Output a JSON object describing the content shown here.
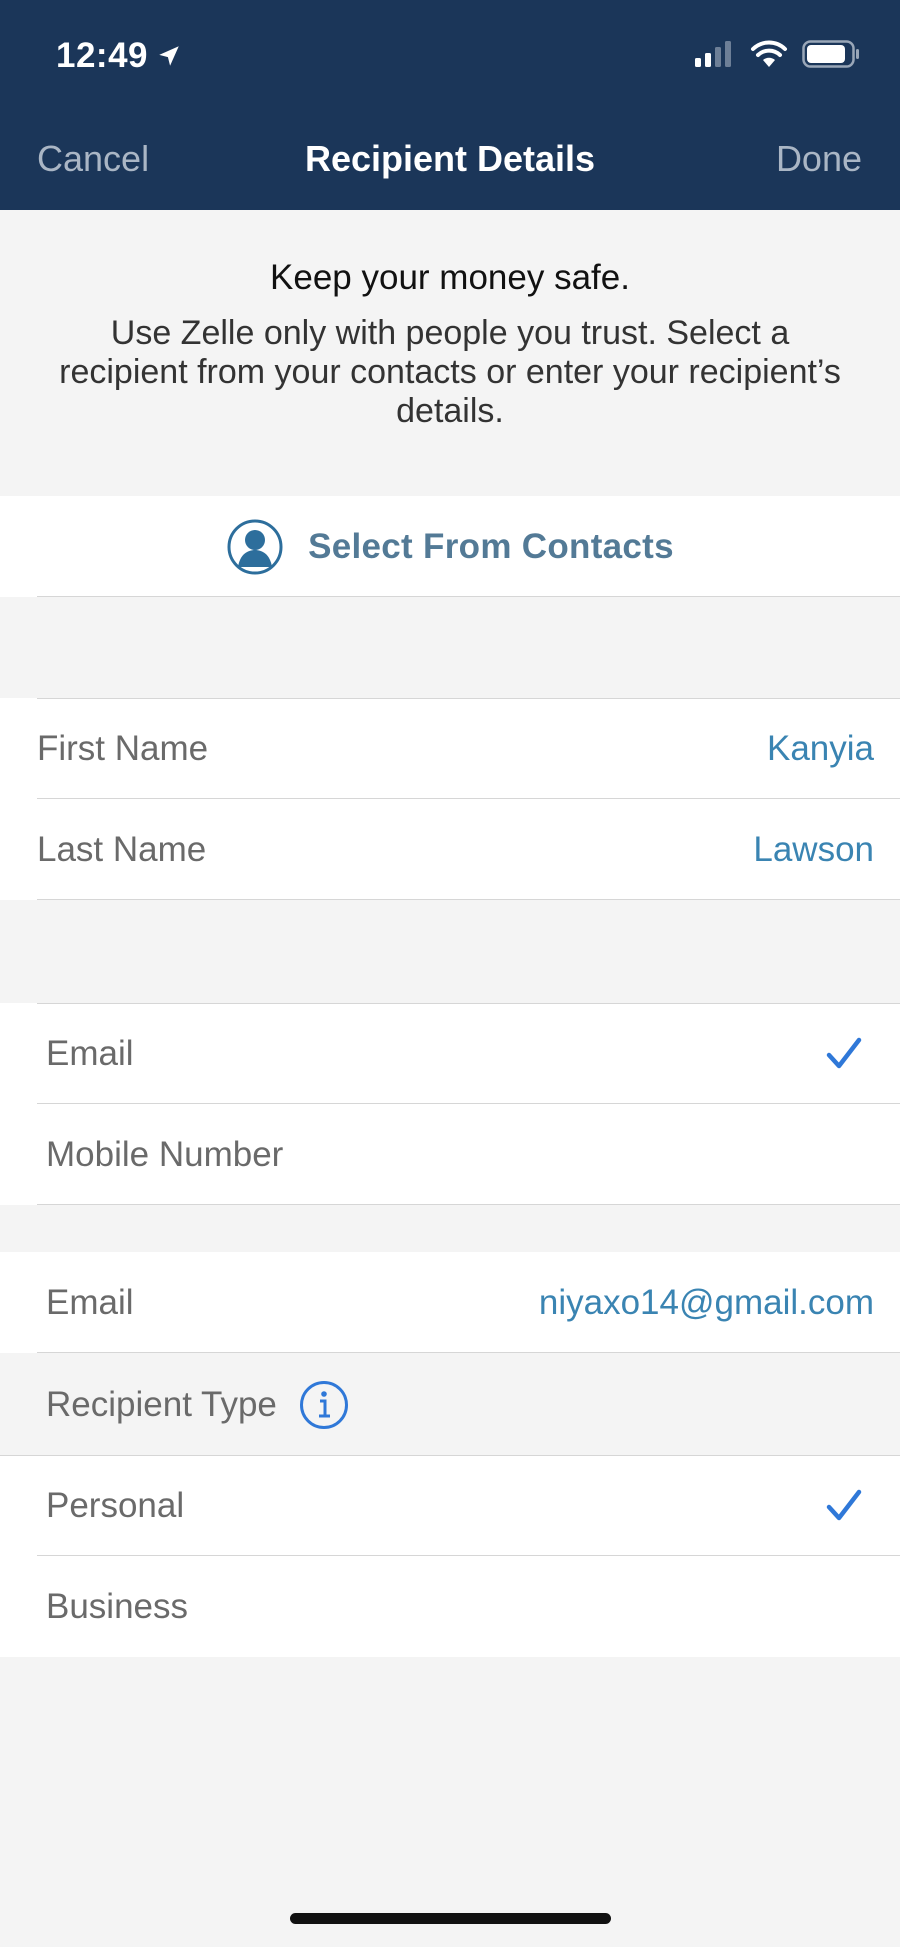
{
  "status_bar": {
    "time": "12:49"
  },
  "nav": {
    "cancel": "Cancel",
    "title": "Recipient Details",
    "done": "Done"
  },
  "intro": {
    "heading": "Keep your money safe.",
    "body": "Use Zelle only with people you trust. Select a recipient from your contacts or enter your recipient’s details."
  },
  "contacts": {
    "label": "Select From Contacts"
  },
  "name": {
    "first_label": "First Name",
    "first_value": "Kanyia",
    "last_label": "Last Name",
    "last_value": "Lawson"
  },
  "method": {
    "email_label": "Email",
    "mobile_label": "Mobile Number",
    "selected": "email"
  },
  "email": {
    "label": "Email",
    "value": "niyaxo14@gmail.com"
  },
  "recipient_type": {
    "label": "Recipient Type",
    "personal": "Personal",
    "business": "Business",
    "selected": "personal"
  },
  "colors": {
    "header_bg": "#1b3659",
    "accent": "#3a84b2",
    "check": "#2f78d8"
  }
}
